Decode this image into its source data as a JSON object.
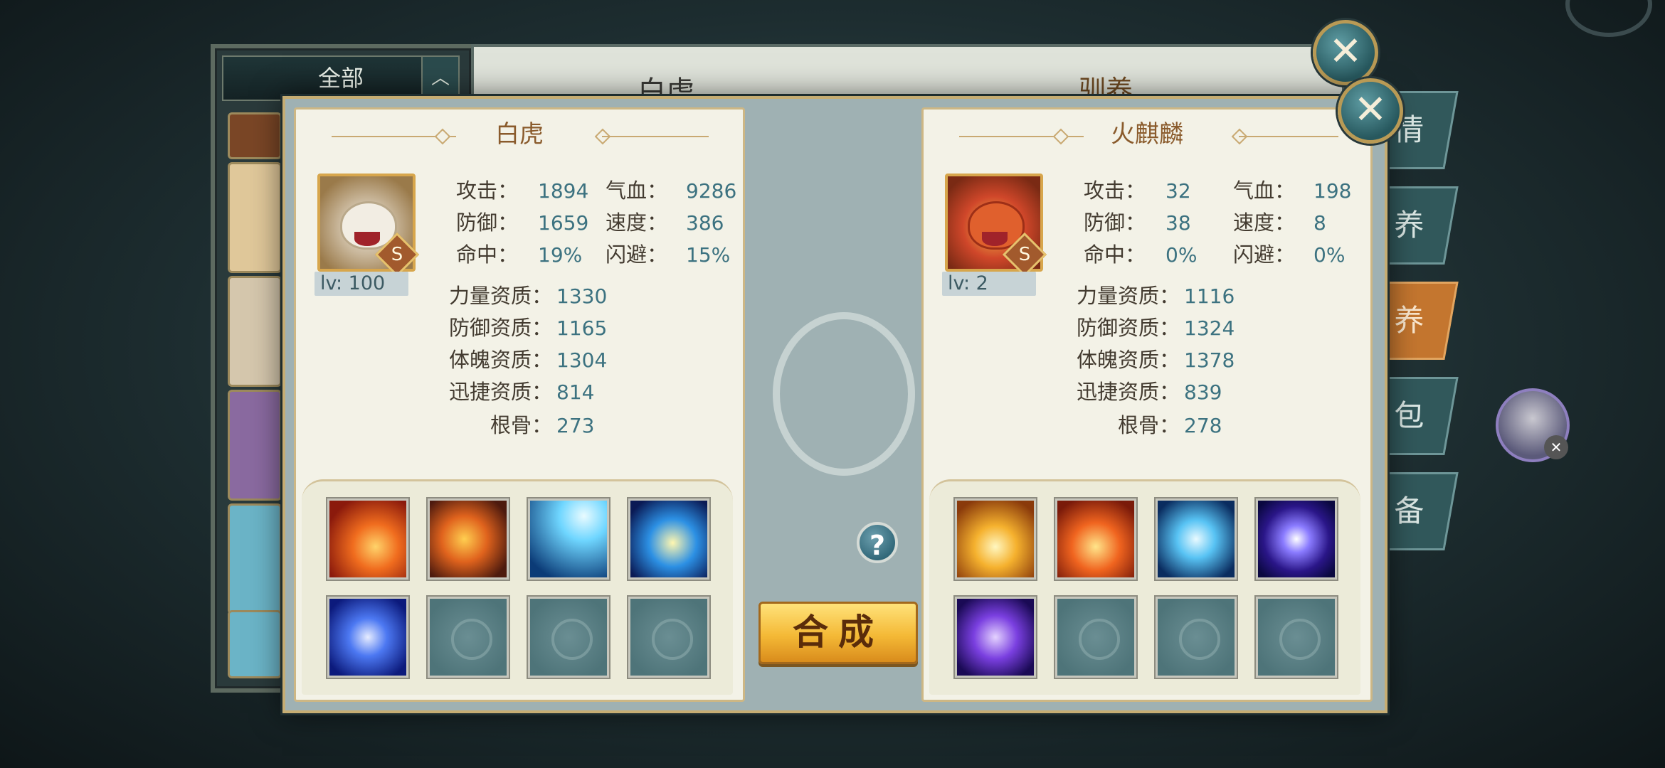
{
  "background": {
    "filter_label": "全部",
    "panel_title": "白虎",
    "panel_subtitle": "驯养",
    "tabs": [
      "情",
      "眼 养",
      "驯 养",
      "背 包",
      "装 备"
    ]
  },
  "help_symbol": "?",
  "merge_button": "合成",
  "left_pet": {
    "name": "白虎",
    "grade": "S",
    "level": "lv: 100",
    "stats": [
      {
        "key": "攻击：",
        "value": "1894"
      },
      {
        "key": "气血：",
        "value": "9286"
      },
      {
        "key": "防御：",
        "value": "1659"
      },
      {
        "key": "速度：",
        "value": "386"
      },
      {
        "key": "命中：",
        "value": "19%"
      },
      {
        "key": "闪避：",
        "value": "15%"
      }
    ],
    "aptitudes": [
      {
        "key": "力量资质：",
        "value": "1330"
      },
      {
        "key": "防御资质：",
        "value": "1165"
      },
      {
        "key": "体魄资质：",
        "value": "1304"
      },
      {
        "key": "迅捷资质：",
        "value": "814"
      },
      {
        "key": "根骨：",
        "value": "273"
      }
    ],
    "skills": [
      "phoenix-fire-skill",
      "flame-orb-skill",
      "lightning-skill",
      "moon-strike-skill",
      "vortex-skill",
      "empty",
      "empty",
      "empty"
    ]
  },
  "right_pet": {
    "name": "火麒麟",
    "grade": "S",
    "level": "lv: 2",
    "stats": [
      {
        "key": "攻击：",
        "value": "32"
      },
      {
        "key": "气血：",
        "value": "198"
      },
      {
        "key": "防御：",
        "value": "38"
      },
      {
        "key": "速度：",
        "value": "8"
      },
      {
        "key": "命中：",
        "value": "0%"
      },
      {
        "key": "闪避：",
        "value": "0%"
      }
    ],
    "aptitudes": [
      {
        "key": "力量资质：",
        "value": "1116"
      },
      {
        "key": "防御资质：",
        "value": "1324"
      },
      {
        "key": "体魄资质：",
        "value": "1378"
      },
      {
        "key": "迅捷资质：",
        "value": "839"
      },
      {
        "key": "根骨：",
        "value": "278"
      }
    ],
    "skills": [
      "holy-burst-skill",
      "fire-explosion-skill",
      "water-heart-skill",
      "arcane-orb-skill",
      "shadow-slash-skill",
      "empty",
      "empty",
      "empty"
    ]
  }
}
